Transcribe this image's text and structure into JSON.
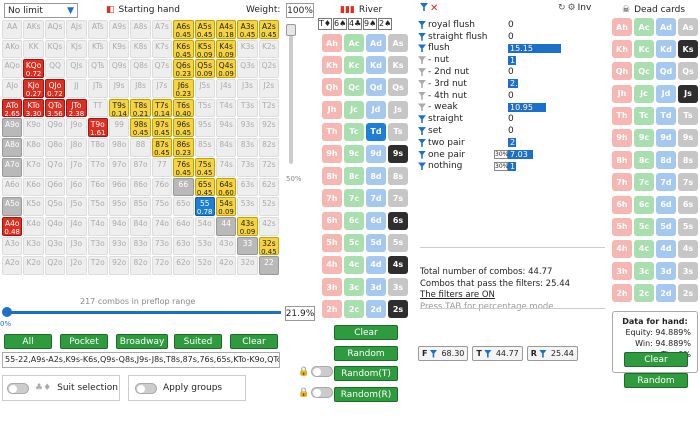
{
  "top": {
    "limit": "No limit",
    "starting_hand": "Starting hand",
    "weight_label": "Weight:",
    "weight_value": "100%"
  },
  "grid": [
    [
      "AA",
      "AKs",
      "AQs",
      "AJs",
      "ATs",
      "A9s",
      "A8s",
      "A7s",
      "A6s|0.45",
      "A5s|0.45",
      "A4s|0.18",
      "A3s|0.45",
      "A2s|0.45"
    ],
    [
      "AKo",
      "KK",
      "KQs",
      "KJs",
      "KTs",
      "K9s",
      "K8s",
      "K7s",
      "K6s|0.45",
      "K5s|0.09",
      "K4s|0.09",
      "K3s",
      "K2s"
    ],
    [
      "AQo",
      "KQo|0.72",
      "QQ",
      "QJs",
      "QTs",
      "Q9s",
      "Q8s",
      "Q7s",
      "Q6s|0.23",
      "Q5s|0.09",
      "Q4s|0.09",
      "Q3s",
      "Q2s"
    ],
    [
      "AJo",
      "KJo|0.27",
      "QJo|0.72",
      "JJ",
      "JTs",
      "J9s",
      "J8s",
      "J7s",
      "J6s|0.23",
      "J5s",
      "J4s",
      "J3s",
      "J2s"
    ],
    [
      "ATo|2.65",
      "KTo|3.30",
      "QTo|3.56",
      "JTo|2.38",
      "TT",
      "T9s|0.14",
      "T8s|0.21",
      "T7s|0.14",
      "T6s|0.40",
      "T5s",
      "T4s",
      "T3s",
      "T2s"
    ],
    [
      "A9o",
      "K9o",
      "Q9o",
      "J9o",
      "T9o|1.61",
      "99",
      "98s|0.45",
      "97s|0.45",
      "96s|0.45",
      "95s",
      "94s",
      "93s",
      "92s"
    ],
    [
      "A8o",
      "K8o",
      "Q8o",
      "J8o",
      "T8o",
      "98o",
      "88",
      "87s|0.45",
      "86s|0.23",
      "85s",
      "84s",
      "83s",
      "82s"
    ],
    [
      "A7o",
      "K7o",
      "Q7o",
      "J7o",
      "T7o",
      "97o",
      "87o",
      "77",
      "76s|0.45",
      "75s|0.45",
      "74s",
      "73s",
      "72s"
    ],
    [
      "A6o",
      "K6o",
      "Q6o",
      "J6o",
      "T6o",
      "96o",
      "86o",
      "76o",
      "66",
      "65s|0.45",
      "64s|0.60",
      "63s",
      "62s"
    ],
    [
      "A5o",
      "K5o",
      "Q5o",
      "J5o",
      "T5o",
      "95o",
      "85o",
      "75o",
      "65o",
      "55|0.78",
      "54s|0.09",
      "53s",
      "52s"
    ],
    [
      "A4o|0.48",
      "K4o",
      "Q4o",
      "J4o",
      "T4o",
      "94o",
      "84o",
      "74o",
      "64o",
      "54o",
      "44",
      "43s|0.09",
      "42s"
    ],
    [
      "A3o",
      "K3o",
      "Q3o",
      "J3o",
      "T3o",
      "93o",
      "83o",
      "73o",
      "63o",
      "53o",
      "43o",
      "33",
      "32s|0.45"
    ],
    [
      "A2o",
      "K2o",
      "Q2o",
      "J2o",
      "T2o",
      "92o",
      "82o",
      "72o",
      "62o",
      "52o",
      "42o",
      "32o",
      "22"
    ]
  ],
  "grid_colors": [
    [
      "g",
      "g",
      "g",
      "g",
      "g",
      "g",
      "g",
      "g",
      "y",
      "y",
      "y",
      "y",
      "y"
    ],
    [
      "g",
      "g",
      "g",
      "g",
      "g",
      "g",
      "g",
      "g",
      "y",
      "y",
      "y",
      "g",
      "g"
    ],
    [
      "g",
      "r",
      "g",
      "g",
      "g",
      "g",
      "g",
      "g",
      "y",
      "y",
      "y",
      "g",
      "g"
    ],
    [
      "g",
      "r",
      "r",
      "g",
      "g",
      "g",
      "g",
      "g",
      "y",
      "g",
      "g",
      "g",
      "g"
    ],
    [
      "r",
      "r",
      "r",
      "r",
      "g",
      "y",
      "y",
      "y",
      "y",
      "g",
      "g",
      "g",
      "g"
    ],
    [
      "dg",
      "g",
      "g",
      "g",
      "r",
      "g",
      "y",
      "y",
      "y",
      "g",
      "g",
      "g",
      "g"
    ],
    [
      "dg",
      "g",
      "g",
      "g",
      "g",
      "g",
      "g",
      "y",
      "y",
      "g",
      "g",
      "g",
      "g"
    ],
    [
      "dg",
      "g",
      "g",
      "g",
      "g",
      "g",
      "g",
      "g",
      "y",
      "y",
      "g",
      "g",
      "g"
    ],
    [
      "g",
      "g",
      "g",
      "g",
      "g",
      "g",
      "g",
      "g",
      "dg",
      "y",
      "y",
      "g",
      "g"
    ],
    [
      "dg",
      "g",
      "g",
      "g",
      "g",
      "g",
      "g",
      "g",
      "g",
      "b",
      "y",
      "g",
      "g"
    ],
    [
      "r",
      "g",
      "g",
      "g",
      "g",
      "g",
      "g",
      "g",
      "g",
      "g",
      "dg",
      "y",
      "g"
    ],
    [
      "g",
      "g",
      "g",
      "g",
      "g",
      "g",
      "g",
      "g",
      "g",
      "g",
      "g",
      "dg",
      "y"
    ],
    [
      "g",
      "g",
      "g",
      "g",
      "g",
      "g",
      "g",
      "g",
      "g",
      "g",
      "g",
      "g",
      "dg"
    ]
  ],
  "slider_pct": "50%",
  "combos_text": "217 combos in preflop range",
  "range_start": "0%",
  "range_end": "21.9%",
  "buttons": [
    "All",
    "Pocket",
    "Broadway",
    "Suited",
    "Clear"
  ],
  "range_string": "55-22,A9s-A2s,K9s-K6s,Q9s-Q8s,J9s-J8s,T8s,87s,76s,65s,KTo-K9o,QTo-Q9o",
  "suit_selection": "Suit selection",
  "apply_groups": "Apply groups",
  "board": {
    "label": "River",
    "cards": [
      "T",
      "6",
      "4",
      "9",
      "2"
    ],
    "suits": [
      "♦",
      "♠",
      "♣",
      "♠",
      "♠"
    ]
  },
  "board_ranks": [
    "A",
    "K",
    "Q",
    "J",
    "T",
    "9",
    "8",
    "7",
    "6",
    "5",
    "4",
    "3",
    "2"
  ],
  "board_btns": {
    "clear": "Clear",
    "random": "Random",
    "randomT": "Random(T)",
    "randomR": "Random(R)"
  },
  "filters": [
    {
      "name": "royal flush",
      "val": "0",
      "bar": 0
    },
    {
      "name": "straight flush",
      "val": "0",
      "bar": 0
    },
    {
      "name": "flush",
      "val": "15.15",
      "bar": 1
    },
    {
      "name": "- nut",
      "val": "1.30",
      "bar": 0
    },
    {
      "name": "- 2nd nut",
      "val": "0",
      "bar": 0
    },
    {
      "name": "- 3rd nut",
      "val": "2.90",
      "bar": 0
    },
    {
      "name": "- 4th nut",
      "val": "0",
      "bar": 0
    },
    {
      "name": "- weak",
      "val": "10.95",
      "bar": 1
    },
    {
      "name": "straight",
      "val": "0",
      "bar": 0
    },
    {
      "name": "set",
      "val": "0",
      "bar": 0
    },
    {
      "name": "two pair",
      "val": "2",
      "bar": 0
    },
    {
      "name": "one pair",
      "val": "7.03",
      "bar": 1,
      "pct": "30%"
    },
    {
      "name": "nothing",
      "val": "1.26",
      "bar": 0,
      "pct": "30%"
    }
  ],
  "inv_label": "Inv",
  "stats": {
    "l1": "Total number of combos: 44.77",
    "l2": "Combos that pass the filters: 25.44",
    "l3": "The filters are ON",
    "l4": "Press TAB for percentage mode"
  },
  "chips": [
    {
      "k": "F",
      "v": "68.30"
    },
    {
      "k": "T",
      "v": "44.77"
    },
    {
      "k": "R",
      "v": "25.44"
    }
  ],
  "dead": {
    "label": "Dead cards",
    "clear": "Clear",
    "random": "Random"
  },
  "hand": {
    "title": "Data for hand:",
    "equity": "Equity: 94.889%",
    "win": "Win: 94.889%",
    "tie": "Tie: 0%"
  },
  "colors": {
    "green": "#2e9c3e",
    "blue": "#1d6fcc",
    "red": "#dd2e20",
    "yellow": "#f5d342"
  }
}
